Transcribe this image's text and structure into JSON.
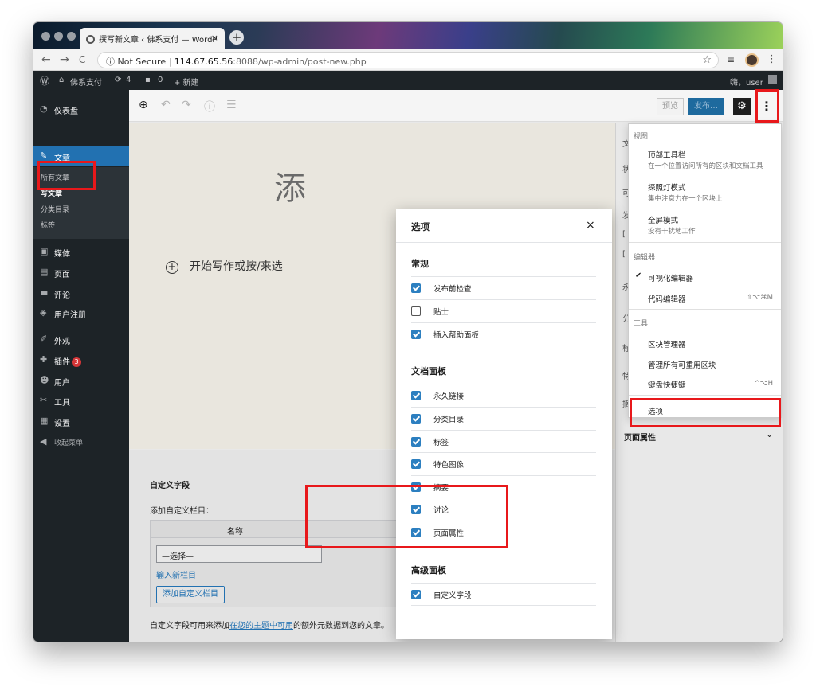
{
  "browser": {
    "tab_title": "撰写新文章 ‹ 佛系支付 — WordP",
    "tab_close": "×",
    "new_tab": "+",
    "nav_back": "←",
    "nav_forward": "→",
    "nav_reload": "C",
    "security_label": "Not Secure",
    "url_host": "114.67.65.56",
    "url_path": ":8088/wp-admin/post-new.php",
    "star": "☆",
    "menu_dots": "⋮"
  },
  "adminbar": {
    "site_name": "佛系支付",
    "updates_count": "4",
    "comments_count": "0",
    "new_label": "+ 新建",
    "greeting": "嗨，user"
  },
  "sidebar": {
    "dashboard": "仪表盘",
    "posts": "文章",
    "posts_sub": [
      "所有文章",
      "写文章",
      "分类目录",
      "标签"
    ],
    "media": "媒体",
    "pages": "页面",
    "comments": "评论",
    "user_reg": "用户注册",
    "appearance": "外观",
    "plugins": "插件",
    "plugins_badge": "3",
    "users": "用户",
    "tools": "工具",
    "settings": "设置",
    "collapse": "收起菜单"
  },
  "editor": {
    "preview": "预览",
    "publish": "发布…",
    "title_placeholder_partial": "添",
    "appender_text": "开始写作或按/来选",
    "custom_fields_title": "自定义字段",
    "add_custom_field": "添加自定义栏目：",
    "name_column": "名称",
    "select_placeholder": "—选择—",
    "enter_new": "输入新栏目",
    "add_button": "添加自定义栏目",
    "desc_prefix": "自定义字段可用来添加",
    "desc_link": "在您的主题中可用",
    "desc_suffix": "的额外元数据到您的文章。",
    "page_attributes": "页面属性"
  },
  "more_menu": {
    "view_title": "视图",
    "top_toolbar": "顶部工具栏",
    "top_toolbar_desc": "在一个位置访问所有的区块和文档工具",
    "spotlight": "探照灯模式",
    "spotlight_desc": "集中注意力在一个区块上",
    "fullscreen": "全屏模式",
    "fullscreen_desc": "没有干扰地工作",
    "editor_title": "编辑器",
    "visual_editor": "可视化编辑器",
    "code_editor": "代码编辑器",
    "code_editor_shortcut": "⇧⌥⌘M",
    "tools_title": "工具",
    "block_manager": "区块管理器",
    "manage_reusable": "管理所有可重用区块",
    "keyboard_shortcuts": "键盘快捷键",
    "keyboard_shortcuts_key": "^⌥H",
    "options": "选项"
  },
  "options_modal": {
    "title": "选项",
    "close": "×",
    "general_title": "常规",
    "general": [
      {
        "label": "发布前检查",
        "checked": true
      },
      {
        "label": "贴士",
        "checked": false
      },
      {
        "label": "插入帮助面板",
        "checked": true
      }
    ],
    "document_title": "文档面板",
    "document": [
      {
        "label": "永久链接",
        "checked": true
      },
      {
        "label": "分类目录",
        "checked": true
      },
      {
        "label": "标签",
        "checked": true
      },
      {
        "label": "特色图像",
        "checked": true
      },
      {
        "label": "摘要",
        "checked": true
      },
      {
        "label": "讨论",
        "checked": true
      },
      {
        "label": "页面属性",
        "checked": true
      }
    ],
    "advanced_title": "高级面板",
    "advanced": [
      {
        "label": "自定义字段",
        "checked": true
      }
    ]
  },
  "colors": {
    "highlight": "#e8181b",
    "wp_blue": "#2271b1",
    "checkbox_blue": "#2c7fc0",
    "admin_dark": "#1d2327"
  },
  "icons": [
    "wordpress-icon",
    "home-icon",
    "updates-icon",
    "comment-icon",
    "gear-icon",
    "more-vertical-icon",
    "add-block-icon",
    "undo-icon",
    "redo-icon",
    "info-icon",
    "list-view-icon",
    "close-icon",
    "check-icon"
  ]
}
